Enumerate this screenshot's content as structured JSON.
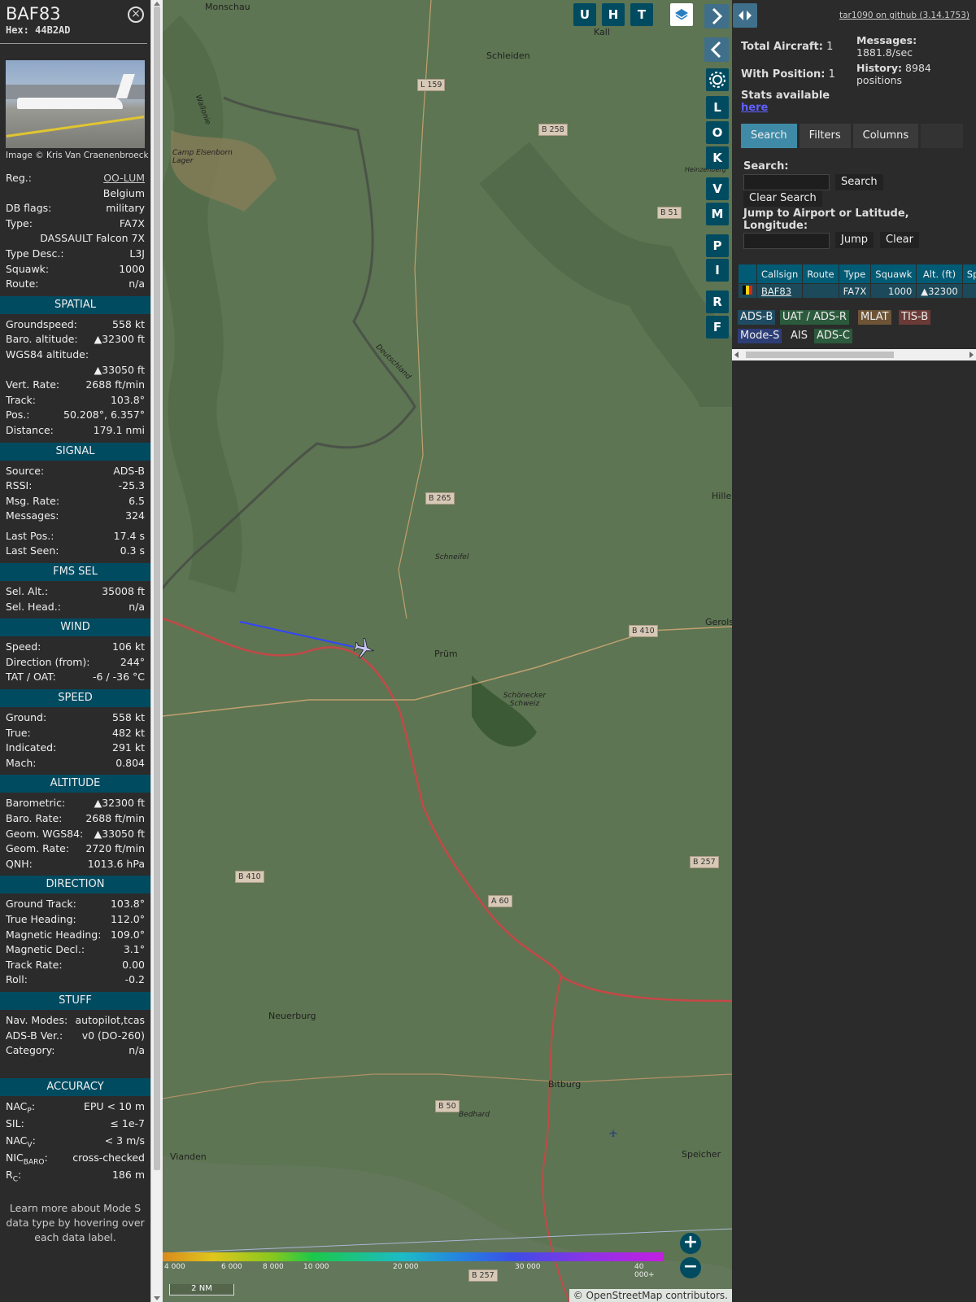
{
  "aircraft": {
    "callsign": "BAF83",
    "hex_label": "Hex:",
    "hex": "44B2AD",
    "photo_credit": "Image © Kris Van Craenenbroeck",
    "close_symbol": "⊗"
  },
  "details": [
    {
      "k": "Reg.:",
      "v": "OO-LUM"
    },
    {
      "k": "",
      "v": "Belgium"
    },
    {
      "k": "DB flags:",
      "v": "military"
    },
    {
      "k": "Type:",
      "v": "FA7X"
    },
    {
      "k": "",
      "v": "DASSAULT Falcon 7X"
    },
    {
      "k": "Type Desc.:",
      "v": "L3J"
    },
    {
      "k": "Squawk:",
      "v": "1000"
    },
    {
      "k": "Route:",
      "v": "n/a"
    }
  ],
  "sections": {
    "spatial": {
      "title": "SPATIAL",
      "rows": [
        {
          "k": "Groundspeed:",
          "v": "558 kt"
        },
        {
          "k": "Baro. altitude:",
          "v": "▲32300 ft"
        },
        {
          "k": "WGS84 altitude:",
          "v": ""
        },
        {
          "k": "",
          "v": "▲33050 ft"
        },
        {
          "k": "Vert. Rate:",
          "v": "2688 ft/min"
        },
        {
          "k": "Track:",
          "v": "103.8°"
        },
        {
          "k": "Pos.:",
          "v": "50.208°, 6.357°"
        },
        {
          "k": "Distance:",
          "v": "179.1 nmi"
        }
      ]
    },
    "signal": {
      "title": "SIGNAL",
      "rows": [
        {
          "k": "Source:",
          "v": "ADS-B"
        },
        {
          "k": "RSSI:",
          "v": "-25.3"
        },
        {
          "k": "Msg. Rate:",
          "v": "6.5"
        },
        {
          "k": "Messages:",
          "v": "324"
        },
        {
          "k": "Last Pos.:",
          "v": "17.4 s"
        },
        {
          "k": "Last Seen:",
          "v": "0.3 s"
        }
      ]
    },
    "fms": {
      "title": "FMS SEL",
      "rows": [
        {
          "k": "Sel. Alt.:",
          "v": "35008 ft"
        },
        {
          "k": "Sel. Head.:",
          "v": "n/a"
        }
      ]
    },
    "wind": {
      "title": "WIND",
      "rows": [
        {
          "k": "Speed:",
          "v": "106 kt"
        },
        {
          "k": "Direction (from):",
          "v": "244°"
        },
        {
          "k": "TAT / OAT:",
          "v": "-6 / -36 °C"
        }
      ]
    },
    "speed": {
      "title": "SPEED",
      "rows": [
        {
          "k": "Ground:",
          "v": "558 kt"
        },
        {
          "k": "True:",
          "v": "482 kt"
        },
        {
          "k": "Indicated:",
          "v": "291 kt"
        },
        {
          "k": "Mach:",
          "v": "0.804"
        }
      ]
    },
    "altitude": {
      "title": "ALTITUDE",
      "rows": [
        {
          "k": "Barometric:",
          "v": "▲32300 ft"
        },
        {
          "k": "Baro. Rate:",
          "v": "2688 ft/min"
        },
        {
          "k": "Geom. WGS84:",
          "v": "▲33050 ft"
        },
        {
          "k": "Geom. Rate:",
          "v": "2720 ft/min"
        },
        {
          "k": "QNH:",
          "v": "1013.6 hPa"
        }
      ]
    },
    "direction": {
      "title": "DIRECTION",
      "rows": [
        {
          "k": "Ground Track:",
          "v": "103.8°"
        },
        {
          "k": "True Heading:",
          "v": "112.0°"
        },
        {
          "k": "Magnetic Heading:",
          "v": "109.0°"
        },
        {
          "k": "Magnetic Decl.:",
          "v": "3.1°"
        },
        {
          "k": "Track Rate:",
          "v": "0.00"
        },
        {
          "k": "Roll:",
          "v": "-0.2"
        }
      ]
    },
    "stuff": {
      "title": "STUFF",
      "rows": [
        {
          "k": "Nav. Modes:",
          "v": "autopilot,tcas"
        },
        {
          "k": "ADS-B Ver.:",
          "v": "v0 (DO-260)"
        },
        {
          "k": "Category:",
          "v": "n/a"
        }
      ]
    },
    "accuracy": {
      "title": "ACCURACY",
      "rows": [
        {
          "k": "NAC",
          "sub": "P",
          "v": "EPU < 10 m"
        },
        {
          "k": "SIL:",
          "sub": "",
          "v": "≤ 1e-7"
        },
        {
          "k": "NAC",
          "sub": "V",
          "v": "< 3 m/s"
        },
        {
          "k": "NIC",
          "sub": "BARO",
          "v": "cross-checked"
        },
        {
          "k": "R",
          "sub": "C",
          "v": "186 m"
        }
      ]
    }
  },
  "footer_note": "Learn more about Mode S data type by hovering over each data label.",
  "map": {
    "top_buttons": [
      "U",
      "H",
      "T"
    ],
    "side_buttons": [
      "L",
      "O",
      "K",
      "V",
      "M",
      "P",
      "I",
      "R",
      "F"
    ],
    "place_labels": [
      {
        "t": "Monschau"
      },
      {
        "t": "Kall"
      },
      {
        "t": "Schleiden"
      },
      {
        "t": "Camp Elsenborn Lager"
      },
      {
        "t": "Wallonie"
      },
      {
        "t": "Deutschland"
      },
      {
        "t": "Heinzenberg"
      },
      {
        "t": "Hille"
      },
      {
        "t": "Schneifel"
      },
      {
        "t": "Prüm"
      },
      {
        "t": "Gerols"
      },
      {
        "t": "Schönecker Schweiz"
      },
      {
        "t": "Neuerburg"
      },
      {
        "t": "Bitburg"
      },
      {
        "t": "Bedhard"
      },
      {
        "t": "Vianden"
      },
      {
        "t": "Speicher"
      }
    ],
    "road_labels": [
      "L 159",
      "B 258",
      "B 51",
      "B 265",
      "B 410",
      "B 410",
      "B 257",
      "A 60",
      "B 50",
      "B 257"
    ],
    "colorbar_ticks": [
      "4 000",
      "6 000",
      "8 000",
      "10 000",
      "20 000",
      "30 000",
      "40 000+"
    ],
    "scale_label": "2 NM",
    "attribution": "© OpenStreetMap contributors.",
    "zoom_in": "+",
    "zoom_out": "−"
  },
  "panel": {
    "github": "tar1090 on github (3.14.1753)",
    "total_aircraft_label": "Total Aircraft:",
    "total_aircraft": "1",
    "with_position_label": "With Position:",
    "with_position": "1",
    "messages_label": "Messages:",
    "messages_rate": "1881.8/sec",
    "history_label": "History:",
    "history_value": "8984 positions",
    "stats_label": "Stats available",
    "stats_link": "here",
    "tabs": [
      "Search",
      "Filters",
      "Columns"
    ],
    "search_label": "Search:",
    "search_button": "Search",
    "clear_search_button": "Clear Search",
    "jump_label": "Jump to Airport or Latitude, Longitude:",
    "jump_button": "Jump",
    "clear_button": "Clear",
    "table_headers": [
      "",
      "Callsign",
      "Route",
      "Type",
      "Squawk",
      "Alt. (ft)",
      "Spd"
    ],
    "table_rows": [
      {
        "flag": "",
        "callsign": "BAF83",
        "route": "",
        "type": "FA7X",
        "squawk": "1000",
        "alt": "▲32300",
        "spd": ""
      }
    ],
    "legend": [
      {
        "t": "ADS-B",
        "bg": "#1f4c62"
      },
      {
        "t": "UAT / ADS-R",
        "bg": "#2c5a3c"
      },
      {
        "t": "MLAT",
        "bg": "#6d5436"
      },
      {
        "t": "TIS-B",
        "bg": "#6a3a36"
      },
      {
        "t": "Mode-S",
        "bg": "#2d3e77"
      },
      {
        "t": "AIS",
        "bg": "transparent"
      },
      {
        "t": "ADS-C",
        "bg": "#2c5a3c"
      }
    ]
  },
  "colors": {
    "section_header": "#014b61",
    "map_background": "#5e7654",
    "track_line": "#3344ff"
  }
}
